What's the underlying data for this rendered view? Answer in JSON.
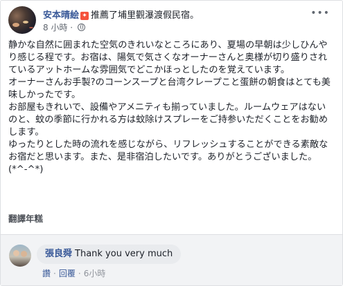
{
  "header": {
    "author": "安本晴絵",
    "badge_text": "✦",
    "action": "推薦了埔里觀瀑渡假民宿。",
    "time": "8 小時",
    "dot": "·",
    "menu": "•••"
  },
  "post": {
    "paragraphs": [
      "静かな自然に囲まれた空気のきれいなところにあり、夏場の早朝は少しひんやり感じる程です。お宿は、陽気で気さくなオーナーさんと奥様が切り盛りされているアットホームな雰囲気でどこかほっとしたのを覚えています。",
      "オーナーさんお手製?のコーンスープと台湾クレープこと蛋餅の朝食はとても美味しかったです。",
      "お部屋もきれいで、設備やアメニティも揃っていました。ルームウェアはないのと、蚊の季節に行かれる方は蚊除けスプレーをご持参いただくことをお勧めします。",
      "ゆったりとした時の流れを感じながら、リフレッシュすることができる素敵なお宿だと思います。また、是非宿泊したいです。ありがとうございました。(*^-^*)"
    ],
    "translate": "翻譯年糕"
  },
  "comment": {
    "author": "張良舜",
    "text": "Thank you very much",
    "like": "讚",
    "reply": "回覆",
    "time": "6小時",
    "sep": "·"
  }
}
